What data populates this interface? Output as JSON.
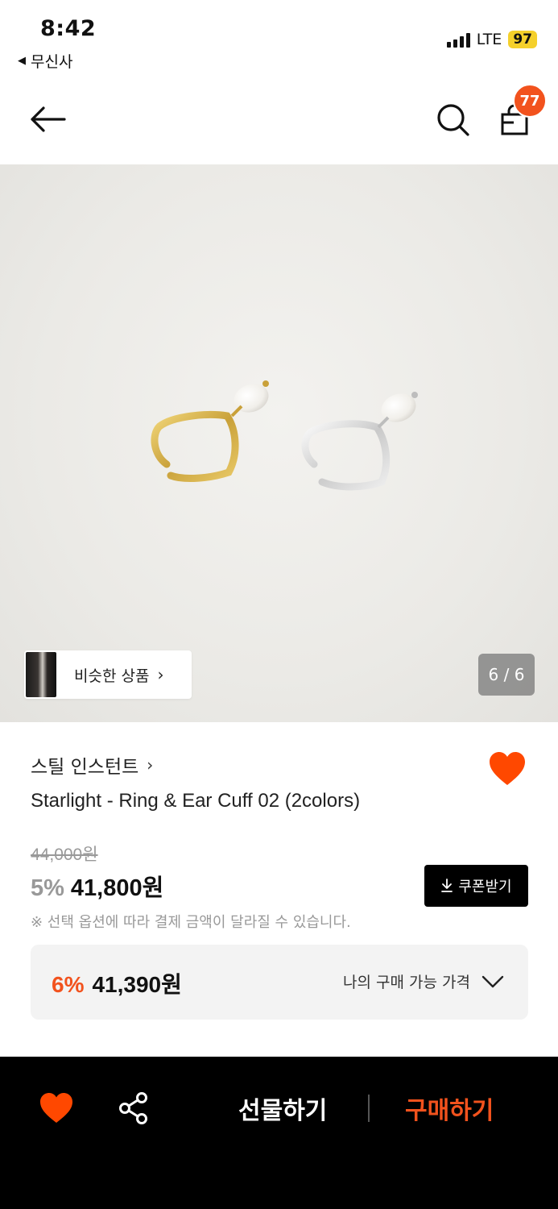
{
  "status_bar": {
    "time": "8:42",
    "back_app": "무신사",
    "network": "LTE",
    "battery": "97"
  },
  "nav": {
    "cart_count": "77"
  },
  "hero": {
    "similar_label": "비슷한 상품",
    "page_indicator": "6 / 6"
  },
  "product": {
    "brand": "스틸 인스턴트",
    "title": "Starlight - Ring & Ear Cuff 02 (2colors)",
    "original_price": "44,000원",
    "discount": "5%",
    "sale_price": "41,800원",
    "coupon_label": "쿠폰받기",
    "notice": "※ 선택 옵션에 따라 결제 금액이 달라질 수 있습니다.",
    "liked": true
  },
  "my_price": {
    "discount": "6%",
    "price": "41,390원",
    "label": "나의 구매 가능 가격"
  },
  "bottom_bar": {
    "gift_label": "선물하기",
    "buy_label": "구매하기"
  },
  "colors": {
    "accent": "#f2521d",
    "heart": "#ff4800",
    "badge": "#f2521d",
    "battery": "#f5d02b"
  },
  "icons": [
    "back-arrow-icon",
    "search-icon",
    "shopping-bag-icon",
    "heart-icon",
    "share-icon",
    "download-icon",
    "chevron-right-icon",
    "chevron-down-icon"
  ]
}
